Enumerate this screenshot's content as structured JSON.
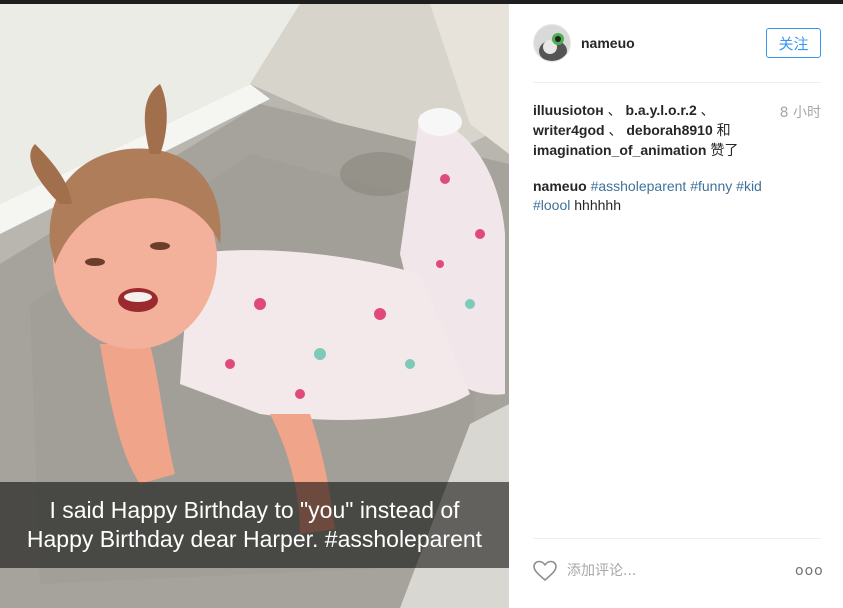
{
  "post": {
    "caption_overlay": "I said Happy Birthday to \"you\" instead of\nHappy Birthday dear Harper. #assholeparent"
  },
  "header": {
    "username": "nameuo",
    "follow_label": "关注"
  },
  "likes": {
    "likers": [
      "illuusiotoн",
      "b.a.y.l.o.r.2",
      "writer4god",
      "deborah8910",
      "imagination_of_animation"
    ],
    "separator": "、",
    "and_word": "和",
    "suffix": "赞了"
  },
  "timestamp": "8 小时",
  "comment": {
    "author": "nameuo",
    "tags": [
      "#assholeparent",
      "#funny",
      "#kid",
      "#loool"
    ],
    "trailing_text": "hhhhhh"
  },
  "actions": {
    "comment_placeholder": "添加评论...",
    "more_label": "ooo"
  },
  "icons": {
    "like": "heart-outline-icon",
    "more": "more-options-icon"
  },
  "colors": {
    "accent": "#3897f0",
    "hashtag": "#3f729b",
    "muted": "#a5a7aa"
  }
}
